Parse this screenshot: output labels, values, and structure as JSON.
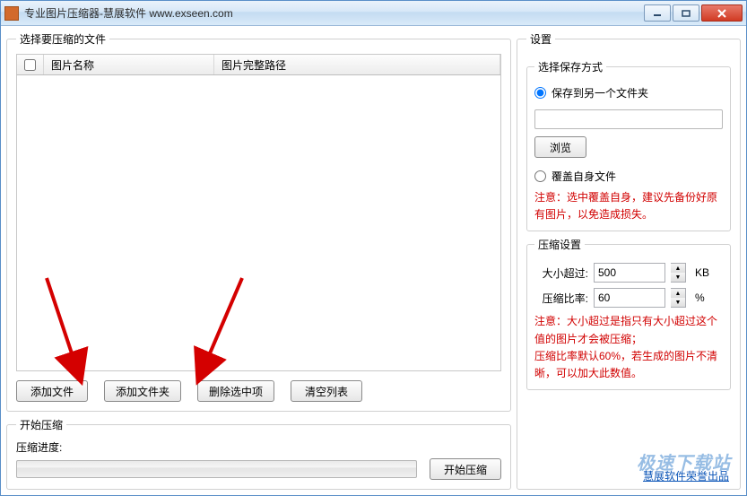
{
  "window": {
    "title": "专业图片压缩器-慧展软件 www.exseen.com"
  },
  "left": {
    "file_group_title": "选择要压缩的文件",
    "col_name": "图片名称",
    "col_path": "图片完整路径",
    "btn_add_file": "添加文件",
    "btn_add_folder": "添加文件夹",
    "btn_delete_selected": "删除选中项",
    "btn_clear_list": "清空列表",
    "compress_group_title": "开始压缩",
    "progress_label": "压缩进度:",
    "btn_start": "开始压缩"
  },
  "right": {
    "settings_title": "设置",
    "save_mode_title": "选择保存方式",
    "radio_save_other": "保存到另一个文件夹",
    "folder_value": "",
    "btn_browse": "浏览",
    "radio_overwrite": "覆盖自身文件",
    "overwrite_warn": "注意：选中覆盖自身，建议先备份好原有图片，以免造成损失。",
    "compress_settings_title": "压缩设置",
    "size_label": "大小超过:",
    "size_value": "500",
    "size_unit": "KB",
    "ratio_label": "压缩比率:",
    "ratio_value": "60",
    "ratio_unit": "%",
    "ratio_warn": "注意：大小超过是指只有大小超过这个值的图片才会被压缩；\n压缩比率默认60%，若生成的图片不清晰，可以加大此数值。",
    "footer_link": "慧展软件荣誉出品"
  },
  "watermark": "极速下载站"
}
